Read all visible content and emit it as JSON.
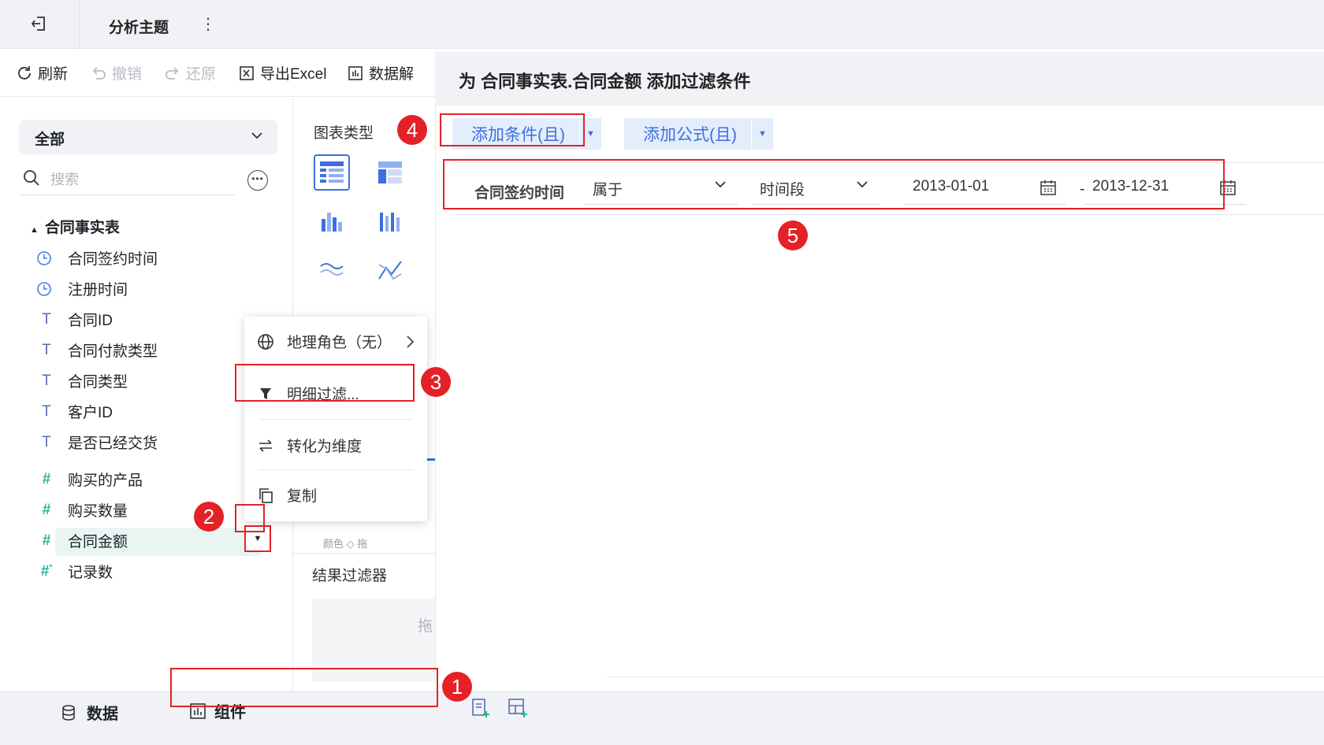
{
  "topbar": {
    "title": "分析主题"
  },
  "toolbar": {
    "refresh": "刷新",
    "undo": "撤销",
    "redo": "还原",
    "export": "导出Excel",
    "data": "数据解"
  },
  "left": {
    "scope": "全部",
    "search_placeholder": "搜索",
    "table_name": "合同事实表",
    "fields": [
      {
        "name": "合同签约时间",
        "icon": "clock-icon"
      },
      {
        "name": "注册时间",
        "icon": "clock-icon"
      },
      {
        "name": "合同ID",
        "icon": "text-type-icon"
      },
      {
        "name": "合同付款类型",
        "icon": "text-type-icon"
      },
      {
        "name": "合同类型",
        "icon": "text-type-icon"
      },
      {
        "name": "客户ID",
        "icon": "text-type-icon"
      },
      {
        "name": "是否已经交货",
        "icon": "text-type-icon"
      },
      {
        "name": "购买的产品",
        "icon": "number-type-icon"
      },
      {
        "name": "购买数量",
        "icon": "number-type-icon"
      },
      {
        "name": "合同金额",
        "icon": "number-type-icon"
      },
      {
        "name": "记录数",
        "icon": "number-type-icon"
      }
    ]
  },
  "mid": {
    "chart_type_label": "图表类型",
    "result_filter_label": "结果过滤器",
    "drop_hint": "拖",
    "partial_tab": "颜色 ◇    拖"
  },
  "context_menu": {
    "geo_role": "地理角色（无）",
    "detail_filter": "明细过滤...",
    "to_dimension": "转化为维度",
    "copy": "复制"
  },
  "dialog": {
    "title": "为 合同事实表.合同金额 添加过滤条件",
    "add_condition": "添加条件(且)",
    "add_formula": "添加公式(且)",
    "condition": {
      "field": "合同签约时间",
      "operator": "属于",
      "mode": "时间段",
      "start": "2013-01-01",
      "dash": "-",
      "end": "2013-12-31"
    }
  },
  "bottom": {
    "tab_data": "数据",
    "tab_component": "组件"
  },
  "badges": [
    "1",
    "2",
    "3",
    "4",
    "5"
  ],
  "colors": {
    "accent": "#3d6fe0",
    "highlight": "#e42127",
    "number_field": "#2db39a"
  }
}
